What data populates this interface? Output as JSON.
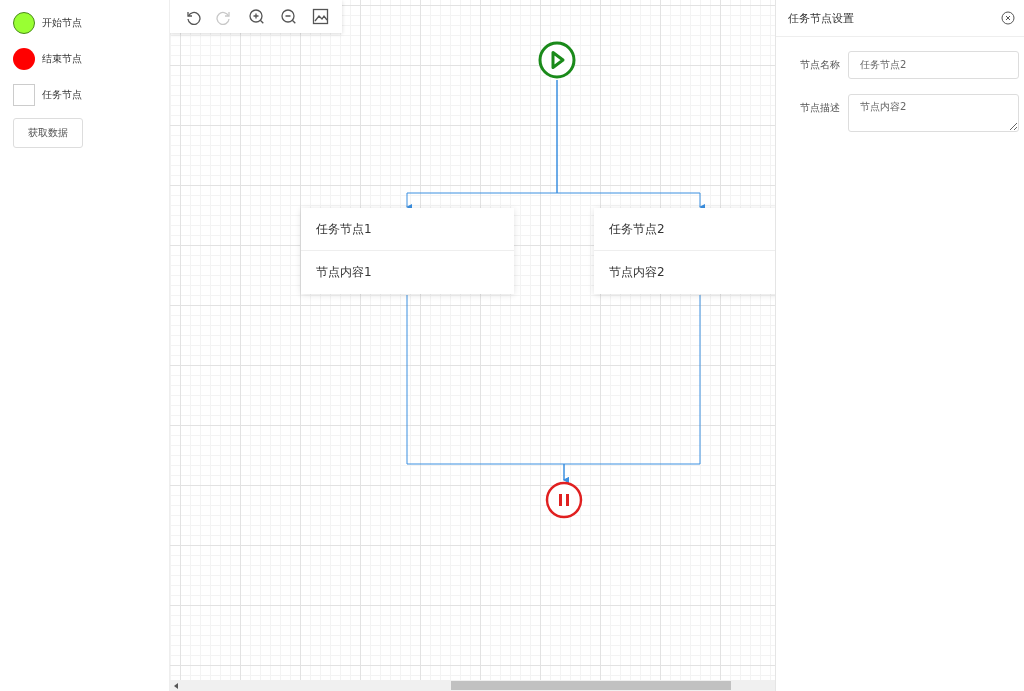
{
  "palette": [
    {
      "kind": "start",
      "label": "开始节点"
    },
    {
      "kind": "end",
      "label": "结束节点"
    },
    {
      "kind": "task",
      "label": "任务节点"
    }
  ],
  "get_data_button": "获取数据",
  "toolbar": [
    {
      "kind": "undo",
      "disabled": false
    },
    {
      "kind": "redo",
      "disabled": true
    },
    {
      "kind": "zoom_in",
      "disabled": false
    },
    {
      "kind": "zoom_out",
      "disabled": false
    },
    {
      "kind": "image",
      "disabled": false
    }
  ],
  "nodes": [
    {
      "kind": "start"
    },
    {
      "kind": "task",
      "title": "任务节点1",
      "content": "节点内容1"
    },
    {
      "kind": "task",
      "title": "任务节点2",
      "content": "节点内容2"
    },
    {
      "kind": "end"
    }
  ],
  "panel": {
    "title": "任务节点设置",
    "fields": [
      {
        "kind": "input",
        "label": "节点名称",
        "value": "任务节点2"
      },
      {
        "kind": "textarea",
        "label": "节点描述",
        "value": "节点内容2"
      }
    ]
  }
}
